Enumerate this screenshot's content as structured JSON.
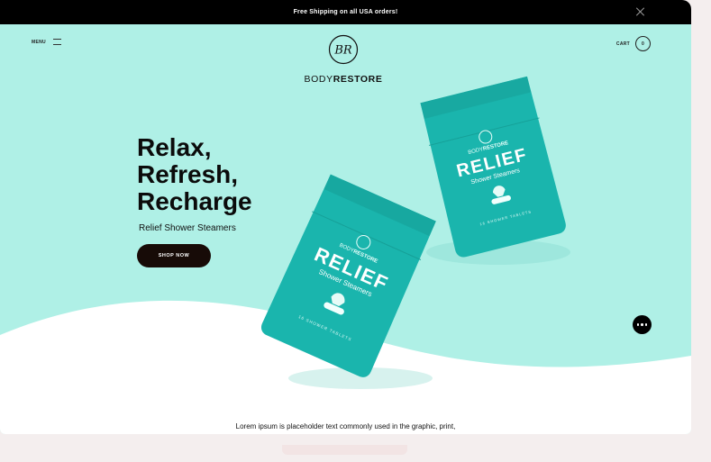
{
  "announcement": {
    "text": "Free Shipping on all USA orders!"
  },
  "header": {
    "menu_label": "MENU",
    "cart_label": "CART",
    "cart_count": "0",
    "logo": {
      "monogram": "BR",
      "word_light": "BODY",
      "word_bold": "RESTORE"
    }
  },
  "hero": {
    "headline_lines": [
      "Relax,",
      "Refresh,",
      "Recharge"
    ],
    "subheadline": "Relief Shower Steamers",
    "cta_label": "SHOP NOW"
  },
  "product": {
    "brand_light": "BODY",
    "brand_bold": "RESTORE",
    "name": "RELIEF",
    "subtitle": "Shower Steamers",
    "tagline": "16 SHOWER TABLETS",
    "color": "#1ab5ad"
  },
  "body": {
    "intro": "Lorem ipsum is placeholder text commonly used in the graphic, print,"
  },
  "colors": {
    "hero_bg": "#aff0e6",
    "announcement_bg": "#000000",
    "cta_bg": "#170b07"
  },
  "icons": {
    "close": "close-icon",
    "menu": "menu-lines-icon",
    "chat": "chat-dots-icon"
  }
}
